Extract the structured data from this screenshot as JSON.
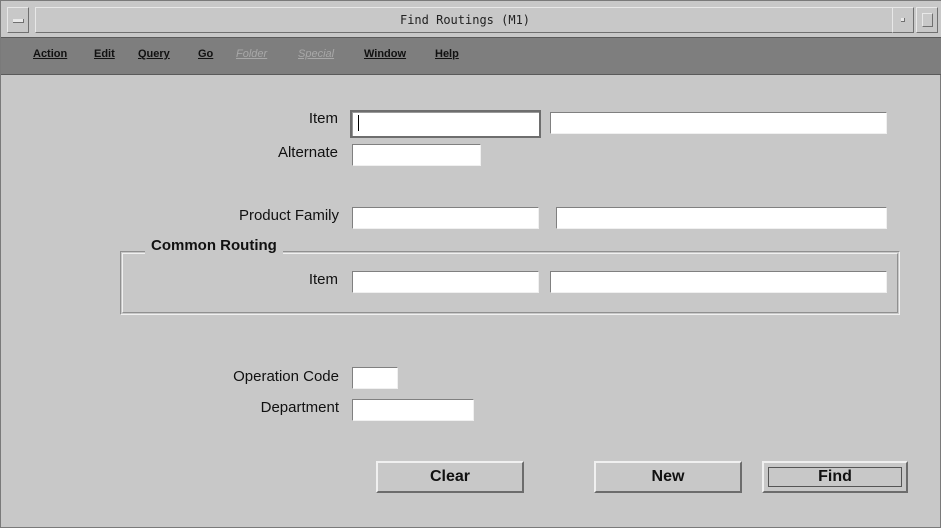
{
  "window": {
    "title": "Find Routings (M1)"
  },
  "menubar": {
    "items": [
      {
        "label": "Action",
        "enabled": true
      },
      {
        "label": "Edit",
        "enabled": true
      },
      {
        "label": "Query",
        "enabled": true
      },
      {
        "label": "Go",
        "enabled": true
      },
      {
        "label": "Folder",
        "enabled": false
      },
      {
        "label": "Special",
        "enabled": false
      },
      {
        "label": "Window",
        "enabled": true
      },
      {
        "label": "Help",
        "enabled": true
      }
    ]
  },
  "form": {
    "item_label": "Item",
    "item_value": "",
    "item_desc_value": "",
    "alternate_label": "Alternate",
    "alternate_value": "",
    "product_family_label": "Product Family",
    "product_family_value": "",
    "product_family_desc_value": "",
    "common_routing": {
      "title": "Common Routing",
      "item_label": "Item",
      "item_value": "",
      "item_desc_value": ""
    },
    "operation_code_label": "Operation Code",
    "operation_code_value": "",
    "department_label": "Department",
    "department_value": ""
  },
  "buttons": {
    "clear": "Clear",
    "new": "New",
    "find": "Find"
  },
  "colors": {
    "background": "#c8c8c8",
    "menubar": "#7e7e7e",
    "field": "#ffffff"
  }
}
